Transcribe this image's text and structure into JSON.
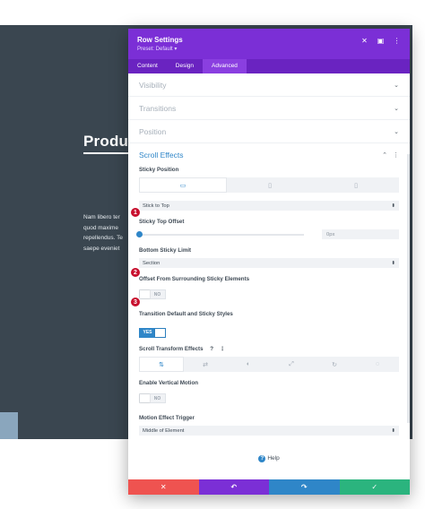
{
  "background": {
    "heading": "Produc",
    "paragraph": [
      "Nam libero ter",
      "quod maxime",
      "repellendus. Te",
      "saepe eveniet"
    ]
  },
  "modal": {
    "title": "Row Settings",
    "preset": "Preset: Default ▾",
    "tabs": [
      "Content",
      "Design",
      "Advanced"
    ],
    "active_tab": "Advanced",
    "collapsed_sections": [
      "Visibility",
      "Transitions",
      "Position"
    ],
    "scroll_effects": {
      "title": "Scroll Effects",
      "sticky_position_label": "Sticky Position",
      "sticky_select": "Stick to Top",
      "sticky_top_offset_label": "Sticky Top Offset",
      "sticky_top_offset_value": "0px",
      "sticky_top_offset_level": 0,
      "bottom_sticky_limit_label": "Bottom Sticky Limit",
      "bottom_sticky_limit_value": "Section",
      "offset_surrounding_label": "Offset From Surrounding Sticky Elements",
      "offset_surrounding_toggle": "NO",
      "transition_default_label": "Transition Default and Sticky Styles",
      "transition_default_toggle": "YES",
      "scroll_transform_label": "Scroll Transform Effects",
      "scroll_transform_help": "?",
      "enable_vertical_label": "Enable Vertical Motion",
      "enable_vertical_toggle": "NO",
      "motion_trigger_label": "Motion Effect Trigger",
      "motion_trigger_value": "Middle of Element"
    },
    "help_label": "Help",
    "footer_colors": {
      "cancel": "#ef5350",
      "undo": "#7b2fd6",
      "redo": "#2f86c8",
      "save": "#2bb47e"
    }
  },
  "callouts": [
    "1",
    "2",
    "3"
  ],
  "colors": {
    "accent": "#2f86c8",
    "header": "#7b2fd6",
    "callout": "#c8102e"
  }
}
